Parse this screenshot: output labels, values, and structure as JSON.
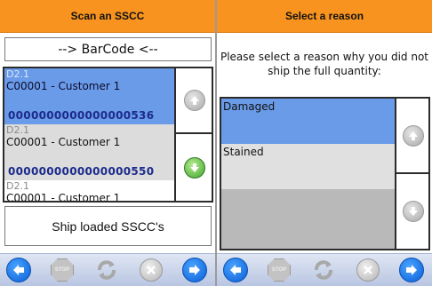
{
  "left": {
    "title": "Scan an SSCC",
    "barcode_text": "--> BarCode <--",
    "items": [
      {
        "code": "D2.1",
        "customer": "C00001 - Customer 1",
        "sscc": "0000000000000000536"
      },
      {
        "code": "D2.1",
        "customer": "C00001 - Customer 1",
        "sscc": "0000000000000000550"
      },
      {
        "code": "D2.1",
        "customer": "C00001 - Customer 1",
        "sscc": ""
      }
    ],
    "ship_label": "Ship loaded SSCC's"
  },
  "right": {
    "title": "Select a reason",
    "instruction": "Please select a reason why you did not ship the full quantity:",
    "reasons": [
      "Damaged",
      "Stained"
    ]
  },
  "toolbar": {
    "stop_label": "STOP"
  },
  "colors": {
    "title_bar": "#f7931e",
    "selected_row": "#6a9be8",
    "sscc_text": "#1c2a8c",
    "toolbar": "#c9d3ea",
    "nav_button": "#1a7be8",
    "confirm_green": "#3ea32e"
  },
  "icons": {
    "scroll_up": "arrow-up-icon",
    "scroll_down": "arrow-down-icon",
    "back": "arrow-left-icon",
    "stop": "stop-icon",
    "refresh": "refresh-icon",
    "cancel": "close-icon",
    "next": "arrow-right-icon"
  }
}
